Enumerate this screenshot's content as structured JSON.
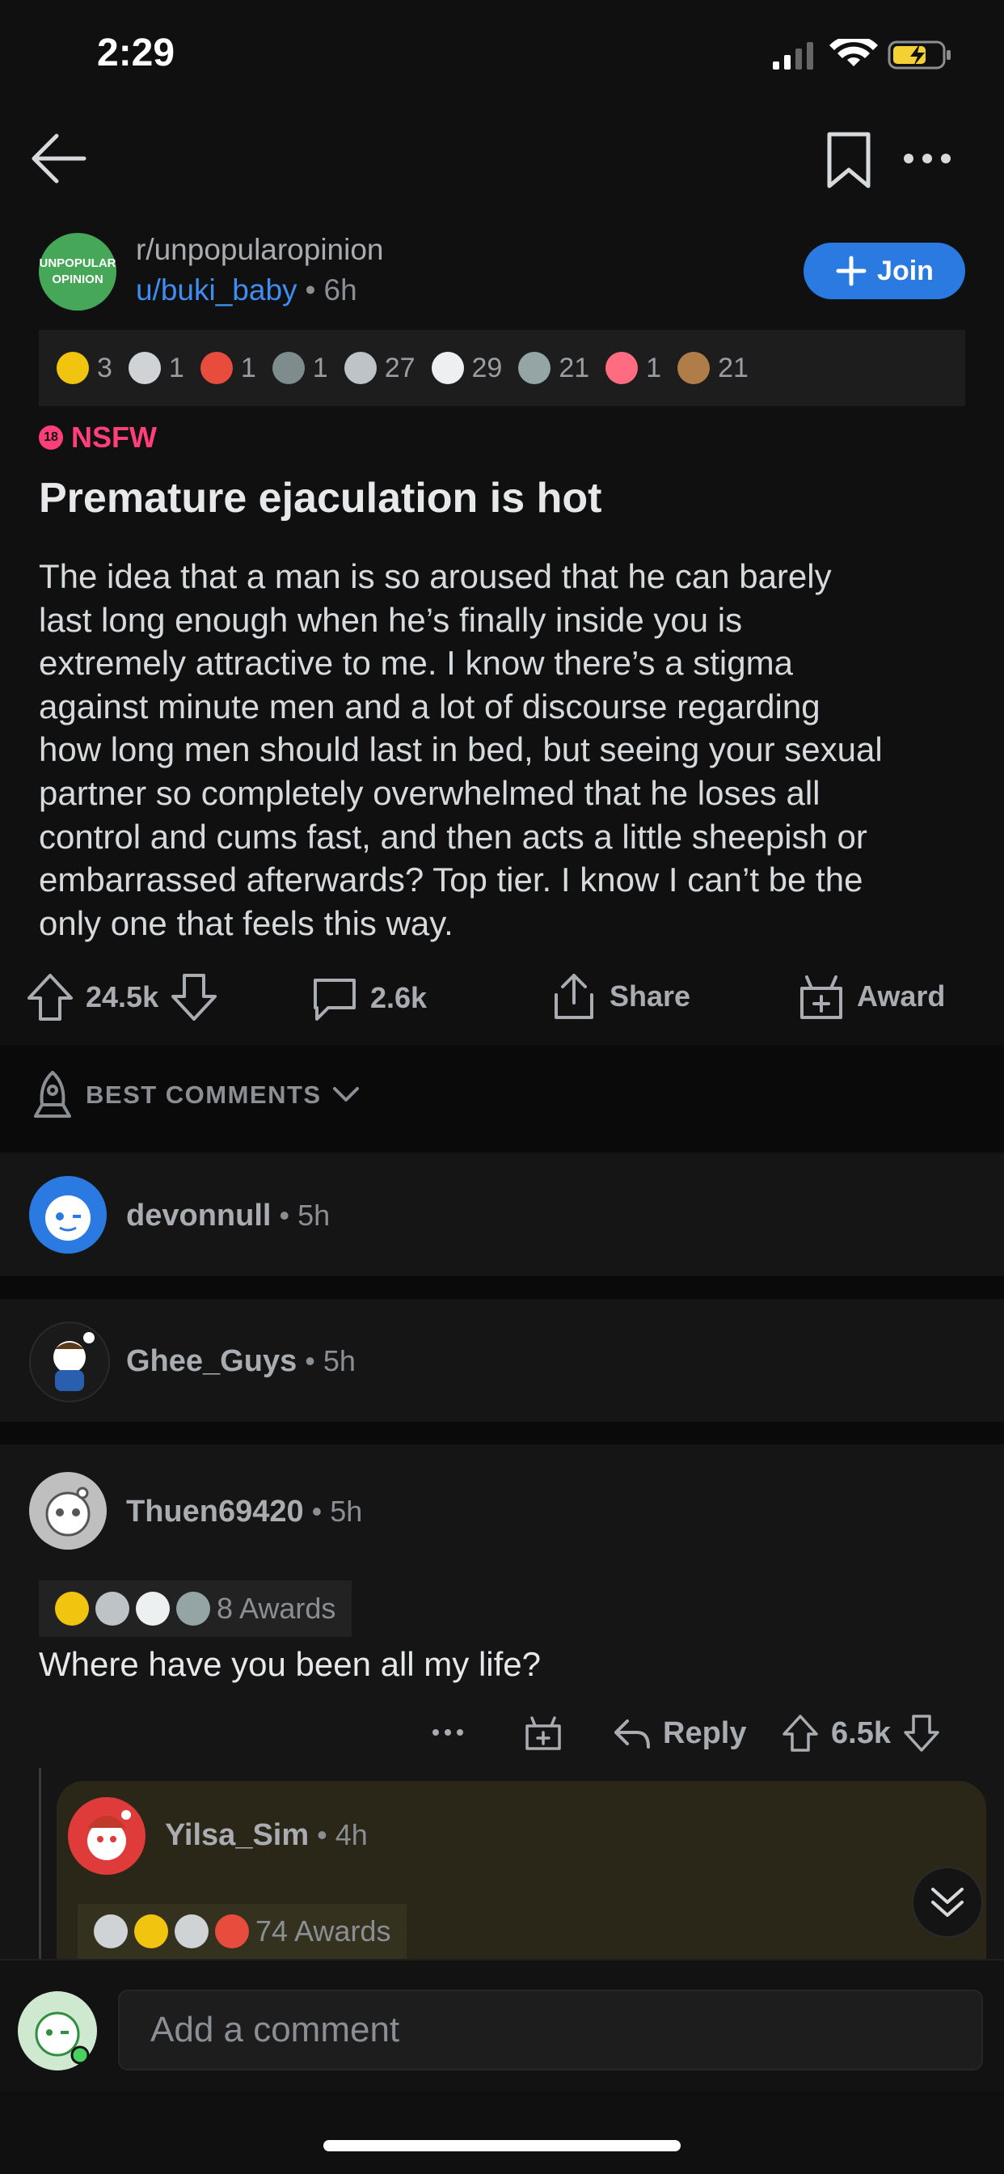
{
  "status_bar": {
    "time": "2:29"
  },
  "post": {
    "subreddit": "r/unpopularopinion",
    "author": "u/buki_baby",
    "age": "6h",
    "join_label": "Join",
    "subreddit_avatar_text": [
      "UNPOPULAR",
      "OPINION"
    ],
    "awards": [
      {
        "icon": "gold-award-icon",
        "count": "3",
        "color": "#f1c40f"
      },
      {
        "icon": "wholesome-award-icon",
        "count": "1",
        "color": "#cfd3d6"
      },
      {
        "icon": "heart-eyes-award-icon",
        "count": "1",
        "color": "#e74c3c"
      },
      {
        "icon": "rocket-award-icon",
        "count": "1",
        "color": "#7f8c8d"
      },
      {
        "icon": "hands-award-icon",
        "count": "27",
        "color": "#bdc3c7"
      },
      {
        "icon": "laugh-award-icon",
        "count": "29",
        "color": "#ecf0f1"
      },
      {
        "icon": "silver-award-icon",
        "count": "21",
        "color": "#95a5a6"
      },
      {
        "icon": "heart-award-icon",
        "count": "1",
        "color": "#ff6b81"
      },
      {
        "icon": "bear-award-icon",
        "count": "21",
        "color": "#b07d48"
      }
    ],
    "nsfw_badge": "18",
    "nsfw_label": "NSFW",
    "title": "Premature ejaculation is hot",
    "body_lines": [
      "The idea that a man is so aroused that he can barely",
      "last long enough when he’s finally inside you is",
      "extremely attractive to me. I know there’s a stigma",
      "against minute men and a lot of discourse regarding",
      "how long men should last in bed, but seeing your sexual",
      "partner so completely overwhelmed that he loses all",
      "control and cums fast, and then acts a little sheepish or",
      "embarrassed afterwards? Top tier. I know I can’t be the",
      "only one that feels this way."
    ],
    "upvotes": "24.5k",
    "comments": "2.6k",
    "share_label": "Share",
    "award_label": "Award"
  },
  "comments_header": {
    "sort_label": "BEST COMMENTS"
  },
  "comments": [
    {
      "user": "devonnull",
      "age": "5h"
    },
    {
      "user": "Ghee_Guys",
      "age": "5h"
    },
    {
      "user": "Thuen69420",
      "age": "5h",
      "awards_label": "8 Awards",
      "text": "Where have you been all my life?",
      "reply_label": "Reply",
      "score": "6.5k"
    }
  ],
  "reply": {
    "user": "Yilsa_Sim",
    "age": "4h",
    "awards_label": "74 Awards"
  },
  "composer": {
    "placeholder": "Add a comment"
  },
  "colors": {
    "accent": "#2a7ae2",
    "nsfw": "#ff3f7a",
    "background": "#101010"
  }
}
